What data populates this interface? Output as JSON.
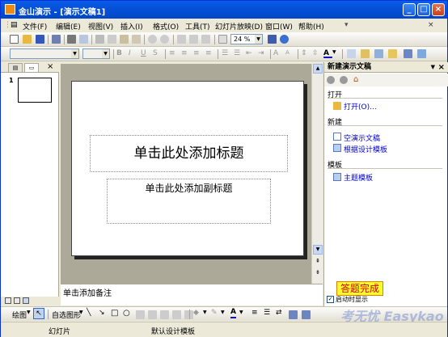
{
  "window": {
    "app_name": "金山演示",
    "doc_name": "[演示文稿1]",
    "separator": "-"
  },
  "menu": [
    "文件(F)",
    "编辑(E)",
    "视图(V)",
    "插入(I)",
    "格式(O)",
    "工具(T)",
    "幻灯片放映(D)",
    "窗口(W)",
    "帮助(H)"
  ],
  "toolbar": {
    "zoom": "24 %"
  },
  "left_panel": {
    "slide_number": "1"
  },
  "slide": {
    "title_placeholder": "单击此处添加标题",
    "subtitle_placeholder": "单击此处添加副标题"
  },
  "notes": {
    "placeholder": "单击添加备注"
  },
  "task_pane": {
    "title": "新建演示文稿",
    "open_section": "打开",
    "open_link": "打开(O)...",
    "new_section": "新建",
    "new_blank": "空演示文稿",
    "new_from_template": "根据设计模板",
    "template_section": "模板",
    "theme_template": "主题模板",
    "show_on_startup": "启动时显示"
  },
  "overlay": {
    "done_badge": "答题完成",
    "watermark": "考无忧 Easykao"
  },
  "drawing_toolbar": {
    "draw_label": "绘图",
    "autoshape_label": "自选图形"
  },
  "status": {
    "slide": "幻灯片",
    "design": "默认设计模板"
  },
  "colors": {
    "title_bar": "#0552d8",
    "badge_bg": "#ffff30",
    "badge_text": "#d00000"
  }
}
